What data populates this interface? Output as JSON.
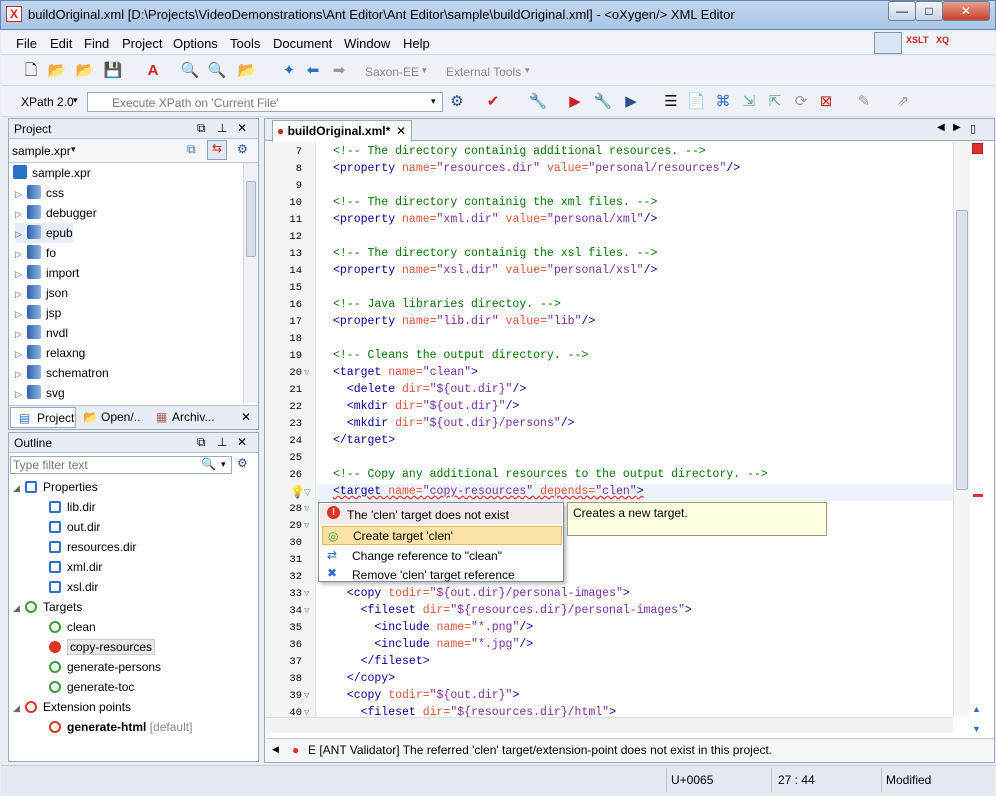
{
  "window": {
    "title": "buildOriginal.xml [D:\\Projects\\VideoDemonstrations\\Ant Editor\\Ant Editor\\sample\\buildOriginal.xml] - <oXygen/> XML Editor"
  },
  "menu": [
    "File",
    "Edit",
    "Find",
    "Project",
    "Options",
    "Tools",
    "Document",
    "Window",
    "Help"
  ],
  "perspectives": [
    "XSLT",
    "XQ"
  ],
  "toolbar": {
    "transform": "Saxon-EE",
    "external": "External Tools"
  },
  "xpath": {
    "version": "XPath 2.0",
    "placeholder": "Execute XPath on  'Current File'"
  },
  "project": {
    "title": "Project",
    "file": "sample.xpr",
    "root": "sample.xpr",
    "items": [
      "css",
      "debugger",
      "epub",
      "fo",
      "import",
      "json",
      "jsp",
      "nvdl",
      "relaxng",
      "schematron",
      "svg"
    ],
    "tabs": [
      "Project",
      "Open/..",
      "Archiv..."
    ]
  },
  "outline": {
    "title": "Outline",
    "filter_placeholder": "Type filter text",
    "properties_label": "Properties",
    "properties": [
      "lib.dir",
      "out.dir",
      "resources.dir",
      "xml.dir",
      "xsl.dir"
    ],
    "targets_label": "Targets",
    "targets": [
      "clean",
      "copy-resources",
      "generate-persons",
      "generate-toc"
    ],
    "ext_label": "Extension points",
    "ext_name": "generate-html",
    "ext_suffix": "[default]"
  },
  "editor": {
    "tab": "buildOriginal.xml*",
    "lines": [
      {
        "n": "7",
        "t": [
          [
            "cm",
            "<!-- The directory containig additional resources. -->"
          ]
        ]
      },
      {
        "n": "8",
        "t": [
          [
            "tg",
            "<property "
          ],
          [
            "an",
            "name="
          ],
          [
            "av",
            "\"resources.dir\" "
          ],
          [
            "an",
            "value="
          ],
          [
            "av",
            "\"personal/resources\""
          ],
          [
            "tg",
            "/>"
          ]
        ]
      },
      {
        "n": "9",
        "t": []
      },
      {
        "n": "10",
        "t": [
          [
            "cm",
            "<!-- The directory containig the xml files. -->"
          ]
        ]
      },
      {
        "n": "11",
        "t": [
          [
            "tg",
            "<property "
          ],
          [
            "an",
            "name="
          ],
          [
            "av",
            "\"xml.dir\" "
          ],
          [
            "an",
            "value="
          ],
          [
            "av",
            "\"personal/xml\""
          ],
          [
            "tg",
            "/>"
          ]
        ]
      },
      {
        "n": "12",
        "t": []
      },
      {
        "n": "13",
        "t": [
          [
            "cm",
            "<!-- The directory containig the xsl files. -->"
          ]
        ]
      },
      {
        "n": "14",
        "t": [
          [
            "tg",
            "<property "
          ],
          [
            "an",
            "name="
          ],
          [
            "av",
            "\"xsl.dir\" "
          ],
          [
            "an",
            "value="
          ],
          [
            "av",
            "\"personal/xsl\""
          ],
          [
            "tg",
            "/>"
          ]
        ]
      },
      {
        "n": "15",
        "t": []
      },
      {
        "n": "16",
        "t": [
          [
            "cm",
            "<!-- Java libraries directoy. -->"
          ]
        ]
      },
      {
        "n": "17",
        "t": [
          [
            "tg",
            "<property "
          ],
          [
            "an",
            "name="
          ],
          [
            "av",
            "\"lib.dir\" "
          ],
          [
            "an",
            "value="
          ],
          [
            "av",
            "\"lib\""
          ],
          [
            "tg",
            "/>"
          ]
        ]
      },
      {
        "n": "18",
        "t": []
      },
      {
        "n": "19",
        "t": [
          [
            "cm",
            "<!-- Cleans the output directory. -->"
          ]
        ]
      },
      {
        "n": "20",
        "t": [
          [
            "tg",
            "<target "
          ],
          [
            "an",
            "name="
          ],
          [
            "av",
            "\"clean\""
          ],
          [
            "tg",
            ">"
          ]
        ]
      },
      {
        "n": "21",
        "t": [
          [
            "tg",
            "  <delete "
          ],
          [
            "an",
            "dir="
          ],
          [
            "av",
            "\"${out.dir}\""
          ],
          [
            "tg",
            "/>"
          ]
        ]
      },
      {
        "n": "22",
        "t": [
          [
            "tg",
            "  <mkdir "
          ],
          [
            "an",
            "dir="
          ],
          [
            "av",
            "\"${out.dir}\""
          ],
          [
            "tg",
            "/>"
          ]
        ]
      },
      {
        "n": "23",
        "t": [
          [
            "tg",
            "  <mkdir "
          ],
          [
            "an",
            "dir="
          ],
          [
            "av",
            "\"${out.dir}/persons\""
          ],
          [
            "tg",
            "/>"
          ]
        ]
      },
      {
        "n": "24",
        "t": [
          [
            "tg",
            "</target>"
          ]
        ]
      },
      {
        "n": "25",
        "t": []
      },
      {
        "n": "26",
        "t": [
          [
            "cm",
            "<!-- Copy any additional resources to the output directory. -->"
          ]
        ]
      },
      {
        "n": "",
        "t": [
          [
            "tg",
            "<target "
          ],
          [
            "an",
            "name="
          ],
          [
            "av",
            "\"copy-resources\" "
          ],
          [
            "an",
            "depends="
          ],
          [
            "av",
            "\"clen\""
          ],
          [
            "tg",
            ">"
          ]
        ]
      },
      {
        "n": "28",
        "t": []
      },
      {
        "n": "29",
        "t": []
      },
      {
        "n": "30",
        "t": []
      },
      {
        "n": "31",
        "t": []
      },
      {
        "n": "32",
        "t": []
      },
      {
        "n": "33",
        "t": [
          [
            "tg",
            "  <copy "
          ],
          [
            "an",
            "todir="
          ],
          [
            "av",
            "\"${out.dir}/personal-images\""
          ],
          [
            "tg",
            ">"
          ]
        ]
      },
      {
        "n": "34",
        "t": [
          [
            "tg",
            "    <fileset "
          ],
          [
            "an",
            "dir="
          ],
          [
            "av",
            "\"${resources.dir}/personal-images\""
          ],
          [
            "tg",
            ">"
          ]
        ]
      },
      {
        "n": "35",
        "t": [
          [
            "tg",
            "      <include "
          ],
          [
            "an",
            "name="
          ],
          [
            "av",
            "\"*.png\""
          ],
          [
            "tg",
            "/>"
          ]
        ]
      },
      {
        "n": "36",
        "t": [
          [
            "tg",
            "      <include "
          ],
          [
            "an",
            "name="
          ],
          [
            "av",
            "\"*.jpg\""
          ],
          [
            "tg",
            "/>"
          ]
        ]
      },
      {
        "n": "37",
        "t": [
          [
            "tg",
            "    </fileset>"
          ]
        ]
      },
      {
        "n": "38",
        "t": [
          [
            "tg",
            "  </copy>"
          ]
        ]
      },
      {
        "n": "39",
        "t": [
          [
            "tg",
            "  <copy "
          ],
          [
            "an",
            "todir="
          ],
          [
            "av",
            "\"${out.dir}\""
          ],
          [
            "tg",
            ">"
          ]
        ]
      },
      {
        "n": "40",
        "t": [
          [
            "tg",
            "    <fileset "
          ],
          [
            "an",
            "dir="
          ],
          [
            "av",
            "\"${resources.dir}/html\""
          ],
          [
            "tg",
            ">"
          ]
        ]
      }
    ]
  },
  "quickfix": {
    "error": "The 'clen' target does not exist",
    "items": [
      "Create target 'clen'",
      "Change reference to \"clean\"",
      "Remove 'clen' target reference"
    ],
    "tooltip": "Creates a new target."
  },
  "problem": {
    "text": "E [ANT Validator] The referred 'clen' target/extension-point does not exist in this project."
  },
  "status": {
    "unicode": "U+0065",
    "position": "27 : 44",
    "state": "Modified"
  }
}
